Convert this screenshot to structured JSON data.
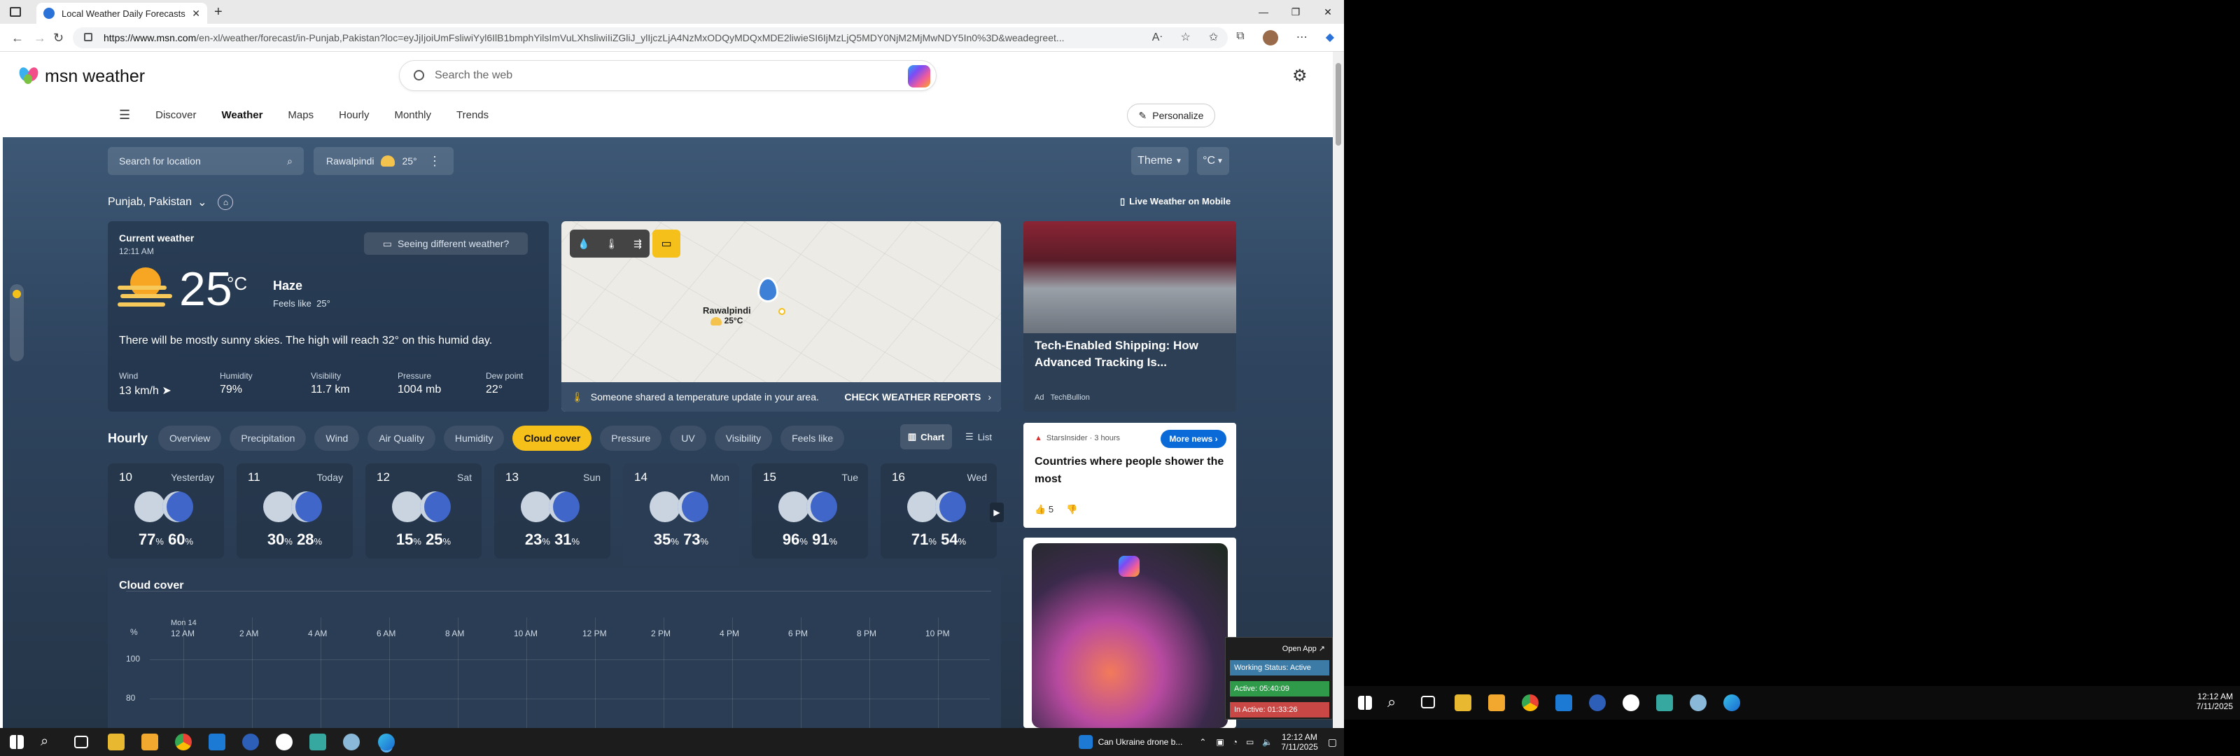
{
  "browser": {
    "tab_title": "Local Weather Daily Forecasts, Ra",
    "url_domain": "https://www.msn.com",
    "url_path": "/en-xl/weather/forecast/in-Punjab,Pakistan?loc=eyJjIjoiUmFsliwiYyl6IlB1bmphYilsImVuLXhsliwiIiZGliJ_ylIjczLjA4NzMxODQyMDQxMDE2liwieSI6IjMzLjQ5MDY0NjM2MjMwNDY5In0%3D&weadegreet..."
  },
  "msn": {
    "logo_text": "msn weather",
    "search_placeholder": "Search the web",
    "menu": [
      "Discover",
      "Weather",
      "Maps",
      "Hourly",
      "Monthly",
      "Trends"
    ],
    "personalize": "Personalize"
  },
  "location": {
    "search_placeholder": "Search for location",
    "saved_city": "Rawalpindi",
    "saved_temp": "25°",
    "region": "Punjab, Pakistan",
    "theme": "Theme",
    "unit": "°C",
    "mobile": "Live Weather on Mobile"
  },
  "current": {
    "heading": "Current weather",
    "time": "12:11 AM",
    "feedback": "Seeing different weather?",
    "temp": "25",
    "unit": "°C",
    "condition": "Haze",
    "feels_like_label": "Feels like",
    "feels_like": "25°",
    "summary": "There will be mostly sunny skies. The high will reach 32° on this humid day.",
    "stats": [
      {
        "label": "Wind",
        "value": "13 km/h"
      },
      {
        "label": "Humidity",
        "value": "79%"
      },
      {
        "label": "Visibility",
        "value": "11.7 km"
      },
      {
        "label": "Pressure",
        "value": "1004 mb"
      },
      {
        "label": "Dew point",
        "value": "22°"
      }
    ]
  },
  "map": {
    "city": "Rawalpindi",
    "temp": "25°C",
    "banner": "Someone shared a temperature update in your area.",
    "banner_cta": "CHECK WEATHER REPORTS"
  },
  "hourly": {
    "title": "Hourly",
    "tabs": [
      "Overview",
      "Precipitation",
      "Wind",
      "Air Quality",
      "Humidity",
      "Cloud cover",
      "Pressure",
      "UV",
      "Visibility",
      "Feels like"
    ],
    "active_tab": "Cloud cover",
    "chart_btn": "Chart",
    "list_btn": "List",
    "days": [
      {
        "date": "10",
        "name": "Yesterday",
        "a": "77",
        "b": "60"
      },
      {
        "date": "11",
        "name": "Today",
        "a": "30",
        "b": "28"
      },
      {
        "date": "12",
        "name": "Sat",
        "a": "15",
        "b": "25"
      },
      {
        "date": "13",
        "name": "Sun",
        "a": "23",
        "b": "31"
      },
      {
        "date": "14",
        "name": "Mon",
        "a": "35",
        "b": "73"
      },
      {
        "date": "15",
        "name": "Tue",
        "a": "96",
        "b": "91"
      },
      {
        "date": "16",
        "name": "Wed",
        "a": "71",
        "b": "54"
      }
    ],
    "pct": "%"
  },
  "cloud_chart": {
    "title": "Cloud cover",
    "ylabel": "%",
    "day_label": "Mon 14",
    "times": [
      "12 AM",
      "2 AM",
      "4 AM",
      "6 AM",
      "8 AM",
      "10 AM",
      "12 PM",
      "2 PM",
      "4 PM",
      "6 PM",
      "8 PM",
      "10 PM"
    ],
    "yticks": [
      "100",
      "80"
    ]
  },
  "news": {
    "n1_title": "Tech-Enabled Shipping: How Advanced Tracking Is...",
    "n1_ad": "Ad",
    "n1_source": "TechBullion",
    "n2_source": "StarsInsider · 3 hours",
    "n2_more": "More news",
    "n2_title": "Countries where people shower the most",
    "n2_likes": "5"
  },
  "popup": {
    "open": "Open App ↗",
    "status": "Working Status: Active",
    "active": "Active: 05:40:09",
    "inactive": "In Active: 01:33:26"
  },
  "taskbar": {
    "news": "Can Ukraine drone b...",
    "time": "12:12 AM",
    "date": "7/11/2025"
  },
  "right_taskbar": {
    "time": "12:12 AM",
    "date": "7/11/2025"
  }
}
